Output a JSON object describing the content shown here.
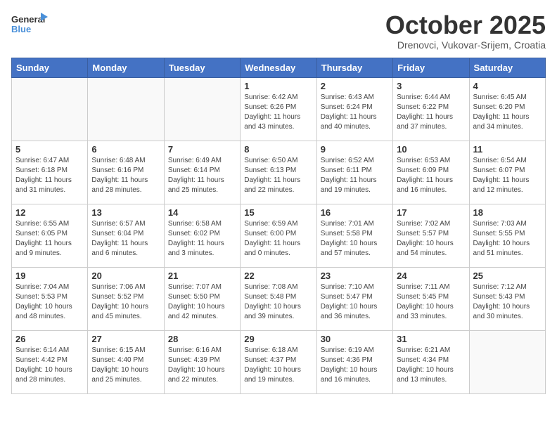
{
  "header": {
    "logo_general": "General",
    "logo_blue": "Blue",
    "month_title": "October 2025",
    "location": "Drenovci, Vukovar-Srijem, Croatia"
  },
  "weekdays": [
    "Sunday",
    "Monday",
    "Tuesday",
    "Wednesday",
    "Thursday",
    "Friday",
    "Saturday"
  ],
  "weeks": [
    [
      {
        "day": "",
        "info": ""
      },
      {
        "day": "",
        "info": ""
      },
      {
        "day": "",
        "info": ""
      },
      {
        "day": "1",
        "info": "Sunrise: 6:42 AM\nSunset: 6:26 PM\nDaylight: 11 hours\nand 43 minutes."
      },
      {
        "day": "2",
        "info": "Sunrise: 6:43 AM\nSunset: 6:24 PM\nDaylight: 11 hours\nand 40 minutes."
      },
      {
        "day": "3",
        "info": "Sunrise: 6:44 AM\nSunset: 6:22 PM\nDaylight: 11 hours\nand 37 minutes."
      },
      {
        "day": "4",
        "info": "Sunrise: 6:45 AM\nSunset: 6:20 PM\nDaylight: 11 hours\nand 34 minutes."
      }
    ],
    [
      {
        "day": "5",
        "info": "Sunrise: 6:47 AM\nSunset: 6:18 PM\nDaylight: 11 hours\nand 31 minutes."
      },
      {
        "day": "6",
        "info": "Sunrise: 6:48 AM\nSunset: 6:16 PM\nDaylight: 11 hours\nand 28 minutes."
      },
      {
        "day": "7",
        "info": "Sunrise: 6:49 AM\nSunset: 6:14 PM\nDaylight: 11 hours\nand 25 minutes."
      },
      {
        "day": "8",
        "info": "Sunrise: 6:50 AM\nSunset: 6:13 PM\nDaylight: 11 hours\nand 22 minutes."
      },
      {
        "day": "9",
        "info": "Sunrise: 6:52 AM\nSunset: 6:11 PM\nDaylight: 11 hours\nand 19 minutes."
      },
      {
        "day": "10",
        "info": "Sunrise: 6:53 AM\nSunset: 6:09 PM\nDaylight: 11 hours\nand 16 minutes."
      },
      {
        "day": "11",
        "info": "Sunrise: 6:54 AM\nSunset: 6:07 PM\nDaylight: 11 hours\nand 12 minutes."
      }
    ],
    [
      {
        "day": "12",
        "info": "Sunrise: 6:55 AM\nSunset: 6:05 PM\nDaylight: 11 hours\nand 9 minutes."
      },
      {
        "day": "13",
        "info": "Sunrise: 6:57 AM\nSunset: 6:04 PM\nDaylight: 11 hours\nand 6 minutes."
      },
      {
        "day": "14",
        "info": "Sunrise: 6:58 AM\nSunset: 6:02 PM\nDaylight: 11 hours\nand 3 minutes."
      },
      {
        "day": "15",
        "info": "Sunrise: 6:59 AM\nSunset: 6:00 PM\nDaylight: 11 hours\nand 0 minutes."
      },
      {
        "day": "16",
        "info": "Sunrise: 7:01 AM\nSunset: 5:58 PM\nDaylight: 10 hours\nand 57 minutes."
      },
      {
        "day": "17",
        "info": "Sunrise: 7:02 AM\nSunset: 5:57 PM\nDaylight: 10 hours\nand 54 minutes."
      },
      {
        "day": "18",
        "info": "Sunrise: 7:03 AM\nSunset: 5:55 PM\nDaylight: 10 hours\nand 51 minutes."
      }
    ],
    [
      {
        "day": "19",
        "info": "Sunrise: 7:04 AM\nSunset: 5:53 PM\nDaylight: 10 hours\nand 48 minutes."
      },
      {
        "day": "20",
        "info": "Sunrise: 7:06 AM\nSunset: 5:52 PM\nDaylight: 10 hours\nand 45 minutes."
      },
      {
        "day": "21",
        "info": "Sunrise: 7:07 AM\nSunset: 5:50 PM\nDaylight: 10 hours\nand 42 minutes."
      },
      {
        "day": "22",
        "info": "Sunrise: 7:08 AM\nSunset: 5:48 PM\nDaylight: 10 hours\nand 39 minutes."
      },
      {
        "day": "23",
        "info": "Sunrise: 7:10 AM\nSunset: 5:47 PM\nDaylight: 10 hours\nand 36 minutes."
      },
      {
        "day": "24",
        "info": "Sunrise: 7:11 AM\nSunset: 5:45 PM\nDaylight: 10 hours\nand 33 minutes."
      },
      {
        "day": "25",
        "info": "Sunrise: 7:12 AM\nSunset: 5:43 PM\nDaylight: 10 hours\nand 30 minutes."
      }
    ],
    [
      {
        "day": "26",
        "info": "Sunrise: 6:14 AM\nSunset: 4:42 PM\nDaylight: 10 hours\nand 28 minutes."
      },
      {
        "day": "27",
        "info": "Sunrise: 6:15 AM\nSunset: 4:40 PM\nDaylight: 10 hours\nand 25 minutes."
      },
      {
        "day": "28",
        "info": "Sunrise: 6:16 AM\nSunset: 4:39 PM\nDaylight: 10 hours\nand 22 minutes."
      },
      {
        "day": "29",
        "info": "Sunrise: 6:18 AM\nSunset: 4:37 PM\nDaylight: 10 hours\nand 19 minutes."
      },
      {
        "day": "30",
        "info": "Sunrise: 6:19 AM\nSunset: 4:36 PM\nDaylight: 10 hours\nand 16 minutes."
      },
      {
        "day": "31",
        "info": "Sunrise: 6:21 AM\nSunset: 4:34 PM\nDaylight: 10 hours\nand 13 minutes."
      },
      {
        "day": "",
        "info": ""
      }
    ]
  ]
}
